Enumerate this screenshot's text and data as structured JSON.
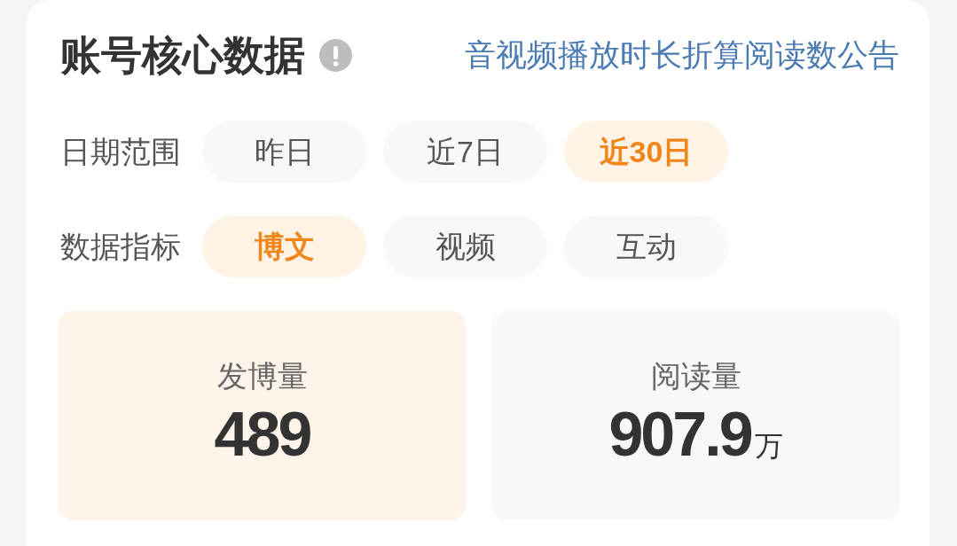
{
  "header": {
    "title": "账号核心数据",
    "link": "音视频播放时长折算阅读数公告"
  },
  "filters": [
    {
      "label": "日期范围",
      "options": [
        {
          "label": "昨日",
          "selected": false
        },
        {
          "label": "近7日",
          "selected": false
        },
        {
          "label": "近30日",
          "selected": true
        }
      ]
    },
    {
      "label": "数据指标",
      "options": [
        {
          "label": "博文",
          "selected": true
        },
        {
          "label": "视频",
          "selected": false
        },
        {
          "label": "互动",
          "selected": false
        }
      ]
    }
  ],
  "stats": [
    {
      "label": "发博量",
      "value": "489",
      "selected": true
    },
    {
      "label": "阅读量",
      "value": "907.9",
      "unit": "万",
      "selected": false
    }
  ]
}
